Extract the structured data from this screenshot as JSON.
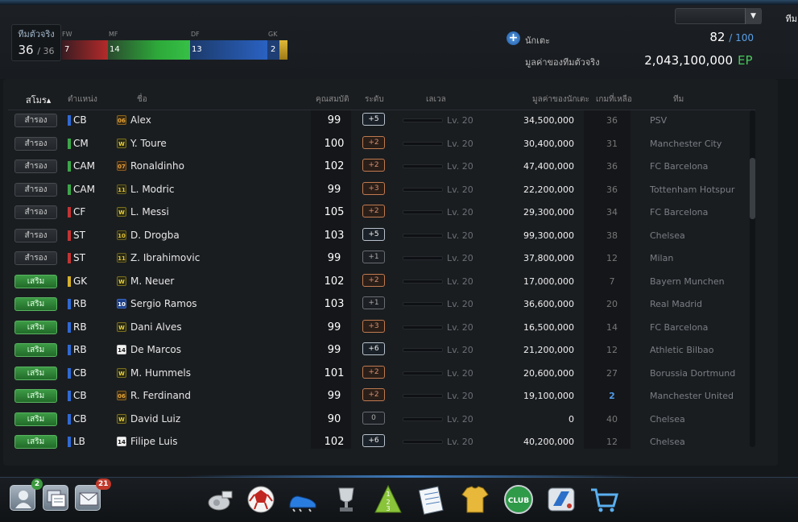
{
  "header": {
    "team_select": {
      "value": "ทีม"
    },
    "real_team": {
      "label": "ทีมตัวจริง",
      "count": "36",
      "max": "/ 36"
    },
    "position_bar": {
      "labels": [
        "FW",
        "MF",
        "DF",
        "GK"
      ],
      "counts": [
        "7",
        "14",
        "13",
        "2"
      ]
    },
    "players": {
      "label": "นักเตะ",
      "count": "82",
      "max": "/ 100"
    },
    "team_value": {
      "label": "มูลค่าของทีมตัวจริง",
      "amount": "2,043,100,000",
      "unit": "EP"
    }
  },
  "table": {
    "headers": {
      "club": "สโมร▴",
      "position": "ตำแหน่ง",
      "name": "ชื่อ",
      "attributes": "คุณสมบัติ",
      "rank": "ระดับ",
      "level": "เลเวล",
      "value": "มูลค่าของนักเตะ",
      "games_left": "เกมที่เหลือ",
      "team": "ทีม"
    },
    "rows": [
      {
        "status": "สำรอง",
        "status_type": "sub",
        "pos": "CB",
        "pos_color": "#2f6ad6",
        "season": "06",
        "season_type": "06",
        "name": "Alex",
        "ovr": "99",
        "rank": "+5",
        "rank_style": "w",
        "level": "Lv. 20",
        "value": "34,500,000",
        "games": "36",
        "games_hi": false,
        "team": "PSV"
      },
      {
        "status": "สำรอง",
        "status_type": "sub",
        "pos": "CM",
        "pos_color": "#3ca64a",
        "season": "W",
        "season_type": "W",
        "name": "Y. Toure",
        "ovr": "100",
        "rank": "+2",
        "rank_style": "o",
        "level": "Lv. 20",
        "value": "30,400,000",
        "games": "31",
        "games_hi": false,
        "team": "Manchester City"
      },
      {
        "status": "สำรอง",
        "status_type": "sub",
        "pos": "CAM",
        "pos_color": "#3ca64a",
        "season": "07",
        "season_type": "07",
        "name": "Ronaldinho",
        "ovr": "102",
        "rank": "+2",
        "rank_style": "o",
        "level": "Lv. 20",
        "value": "47,400,000",
        "games": "36",
        "games_hi": false,
        "team": "FC Barcelona"
      },
      {
        "status": "สำรอง",
        "status_type": "sub",
        "pos": "CAM",
        "pos_color": "#3ca64a",
        "season": "11",
        "season_type": "11",
        "name": "L. Modric",
        "ovr": "99",
        "rank": "+3",
        "rank_style": "o",
        "level": "Lv. 20",
        "value": "22,200,000",
        "games": "36",
        "games_hi": false,
        "team": "Tottenham Hotspur"
      },
      {
        "status": "สำรอง",
        "status_type": "sub",
        "pos": "CF",
        "pos_color": "#c23434",
        "season": "W",
        "season_type": "W",
        "name": "L. Messi",
        "ovr": "105",
        "rank": "+2",
        "rank_style": "o",
        "level": "Lv. 20",
        "value": "29,300,000",
        "games": "34",
        "games_hi": false,
        "team": "FC Barcelona"
      },
      {
        "status": "สำรอง",
        "status_type": "sub",
        "pos": "ST",
        "pos_color": "#c23434",
        "season": "10",
        "season_type": "10",
        "name": "D. Drogba",
        "ovr": "103",
        "rank": "+5",
        "rank_style": "w",
        "level": "Lv. 20",
        "value": "99,300,000",
        "games": "38",
        "games_hi": false,
        "team": "Chelsea"
      },
      {
        "status": "สำรอง",
        "status_type": "sub",
        "pos": "ST",
        "pos_color": "#c23434",
        "season": "11",
        "season_type": "11",
        "name": "Z. Ibrahimovic",
        "ovr": "99",
        "rank": "+1",
        "rank_style": "g",
        "level": "Lv. 20",
        "value": "37,800,000",
        "games": "12",
        "games_hi": false,
        "team": "Milan"
      },
      {
        "status": "เสริม",
        "status_type": "res",
        "pos": "GK",
        "pos_color": "#d6b02a",
        "season": "W",
        "season_type": "W",
        "name": "M. Neuer",
        "ovr": "102",
        "rank": "+2",
        "rank_style": "o",
        "level": "Lv. 20",
        "value": "17,000,000",
        "games": "7",
        "games_hi": false,
        "team": "Bayern Munchen"
      },
      {
        "status": "เสริม",
        "status_type": "res",
        "pos": "RB",
        "pos_color": "#2f6ad6",
        "season": "10",
        "season_type": "10b",
        "name": "Sergio Ramos",
        "ovr": "103",
        "rank": "+1",
        "rank_style": "g",
        "level": "Lv. 20",
        "value": "36,600,000",
        "games": "20",
        "games_hi": false,
        "team": "Real Madrid"
      },
      {
        "status": "เสริม",
        "status_type": "res",
        "pos": "RB",
        "pos_color": "#2f6ad6",
        "season": "W",
        "season_type": "W",
        "name": "Dani Alves",
        "ovr": "99",
        "rank": "+3",
        "rank_style": "o",
        "level": "Lv. 20",
        "value": "16,500,000",
        "games": "14",
        "games_hi": false,
        "team": "FC Barcelona"
      },
      {
        "status": "เสริม",
        "status_type": "res",
        "pos": "RB",
        "pos_color": "#2f6ad6",
        "season": "14",
        "season_type": "14",
        "name": "De Marcos",
        "ovr": "99",
        "rank": "+6",
        "rank_style": "w",
        "level": "Lv. 20",
        "value": "21,200,000",
        "games": "12",
        "games_hi": false,
        "team": "Athletic Bilbao"
      },
      {
        "status": "เสริม",
        "status_type": "res",
        "pos": "CB",
        "pos_color": "#2f6ad6",
        "season": "W",
        "season_type": "W",
        "name": "M. Hummels",
        "ovr": "101",
        "rank": "+2",
        "rank_style": "o",
        "level": "Lv. 20",
        "value": "20,600,000",
        "games": "27",
        "games_hi": false,
        "team": "Borussia Dortmund"
      },
      {
        "status": "เสริม",
        "status_type": "res",
        "pos": "CB",
        "pos_color": "#2f6ad6",
        "season": "06",
        "season_type": "06",
        "name": "R. Ferdinand",
        "ovr": "99",
        "rank": "+2",
        "rank_style": "o",
        "level": "Lv. 20",
        "value": "19,100,000",
        "games": "2",
        "games_hi": true,
        "team": "Manchester United"
      },
      {
        "status": "เสริม",
        "status_type": "res",
        "pos": "CB",
        "pos_color": "#2f6ad6",
        "season": "W",
        "season_type": "W",
        "name": "David Luiz",
        "ovr": "90",
        "rank": "0",
        "rank_style": "g",
        "level": "Lv. 20",
        "value": "0",
        "games": "40",
        "games_hi": false,
        "team": "Chelsea"
      },
      {
        "status": "เสริม",
        "status_type": "res",
        "pos": "LB",
        "pos_color": "#2f6ad6",
        "season": "14",
        "season_type": "14",
        "name": "Filipe Luis",
        "ovr": "102",
        "rank": "+6",
        "rank_style": "w",
        "level": "Lv. 20",
        "value": "40,200,000",
        "games": "12",
        "games_hi": false,
        "team": "Chelsea"
      }
    ]
  },
  "bottom": {
    "friends_badge": "2",
    "mail_badge": "21",
    "left_icons": [
      "friends-icon",
      "chat-icon",
      "mail-icon"
    ],
    "dock_icons": [
      "whistle-icon",
      "ball-icon",
      "boot-icon",
      "trophy-icon",
      "ranking-icon",
      "notepad-icon",
      "jersey-icon",
      "club-icon",
      "transfer-icon",
      "shop-cart-icon"
    ]
  },
  "colors": {
    "ep": "#48c85c",
    "accent_blue": "#5aa0e8",
    "reserve_green": "#2e8a36"
  }
}
